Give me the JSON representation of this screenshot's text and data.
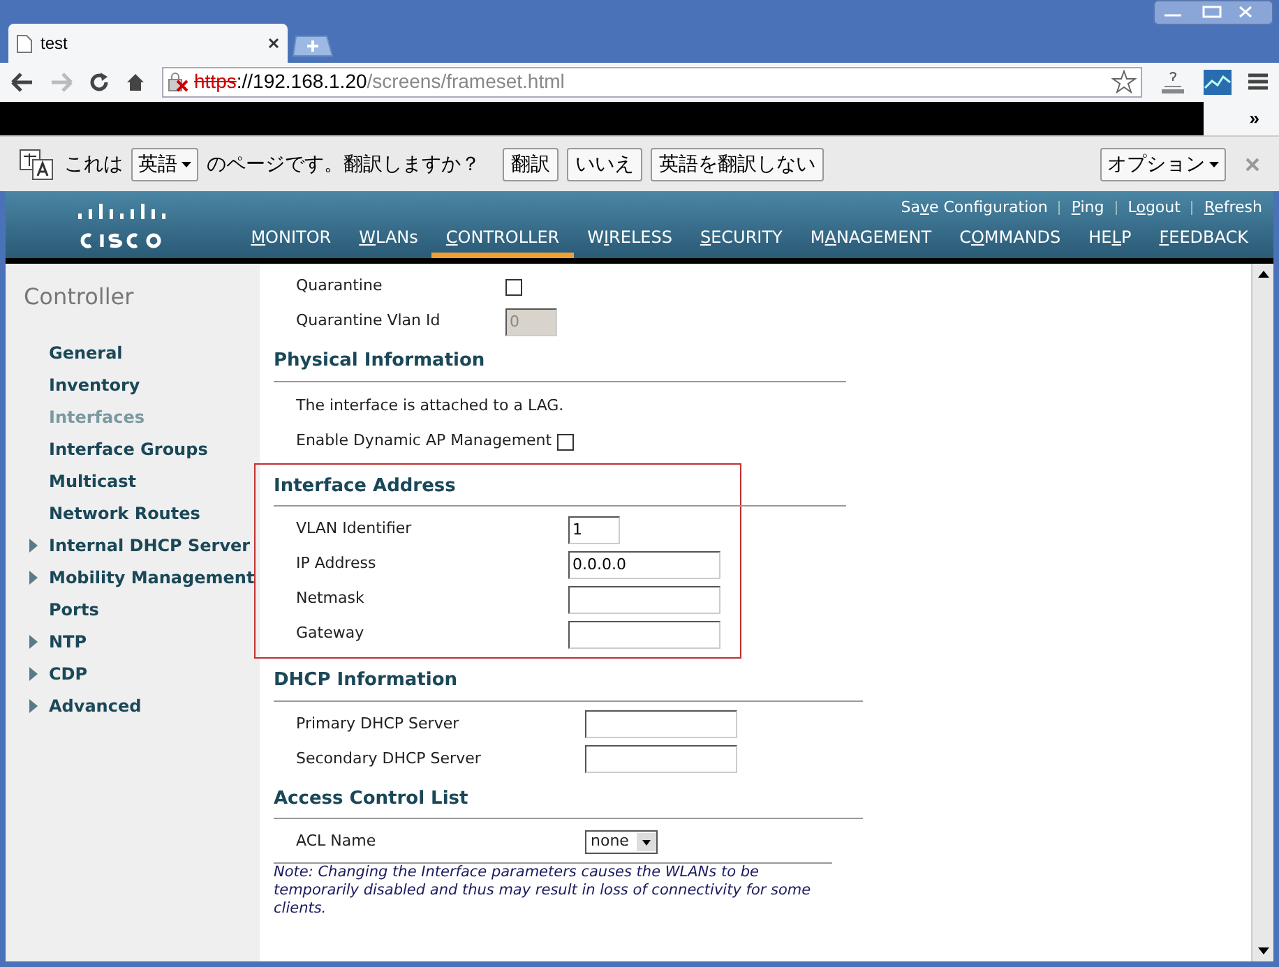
{
  "browser": {
    "tab_title": "test",
    "url_scheme": "https",
    "url_host": "://192.168.1.20",
    "url_path": "/screens/frameset.html",
    "bookmarks_more": "»"
  },
  "translate_bar": {
    "prefix": "これは",
    "language": "英語",
    "suffix": "のページです。翻訳しますか？",
    "buttons": [
      "翻訳",
      "いいえ",
      "英語を翻訳しない"
    ],
    "options": "オプション"
  },
  "header": {
    "links": [
      {
        "pre": "Sa",
        "key": "v",
        "post": "e Configuration"
      },
      {
        "key": "P",
        "post": "ing"
      },
      {
        "pre": "L",
        "key": "o",
        "post": "gout"
      },
      {
        "key": "R",
        "post": "efresh"
      }
    ],
    "nav": [
      {
        "key": "M",
        "post": "ONITOR",
        "selected": false
      },
      {
        "key": "W",
        "post": "LANs",
        "selected": false
      },
      {
        "key": "C",
        "post": "ONTROLLER",
        "selected": true
      },
      {
        "pre": "W",
        "key": "I",
        "post": "RELESS",
        "selected": false
      },
      {
        "key": "S",
        "post": "ECURITY",
        "selected": false
      },
      {
        "pre": "M",
        "key": "A",
        "post": "NAGEMENT",
        "selected": false
      },
      {
        "pre": "C",
        "key": "O",
        "post": "MMANDS",
        "selected": false
      },
      {
        "pre": "HE",
        "key": "L",
        "post": "P",
        "selected": false
      },
      {
        "key": "F",
        "post": "EEDBACK",
        "selected": false
      }
    ]
  },
  "sidebar": {
    "title": "Controller",
    "items": [
      {
        "label": "General",
        "expandable": false,
        "selected": false
      },
      {
        "label": "Inventory",
        "expandable": false,
        "selected": false
      },
      {
        "label": "Interfaces",
        "expandable": false,
        "selected": true
      },
      {
        "label": "Interface Groups",
        "expandable": false,
        "selected": false
      },
      {
        "label": "Multicast",
        "expandable": false,
        "selected": false
      },
      {
        "label": "Network Routes",
        "expandable": false,
        "selected": false
      },
      {
        "label": "Internal DHCP Server",
        "expandable": true,
        "selected": false
      },
      {
        "label": "Mobility Management",
        "expandable": true,
        "selected": false
      },
      {
        "label": "Ports",
        "expandable": false,
        "selected": false
      },
      {
        "label": "NTP",
        "expandable": true,
        "selected": false
      },
      {
        "label": "CDP",
        "expandable": true,
        "selected": false
      },
      {
        "label": "Advanced",
        "expandable": true,
        "selected": false
      }
    ]
  },
  "sections": [
    {
      "highlighted": false,
      "rows": [
        {
          "kind": "checkbox",
          "label": "Quarantine",
          "checked": false
        },
        {
          "kind": "disabled-field",
          "label": "Quarantine Vlan Id",
          "value": "0"
        }
      ]
    },
    {
      "title": "Physical Information",
      "highlighted": false,
      "rows": [
        {
          "kind": "text",
          "label": "The interface is attached to a LAG."
        },
        {
          "kind": "inline-checkbox",
          "label": "Enable Dynamic AP Management",
          "checked": false
        }
      ]
    },
    {
      "title": "Interface Address",
      "highlighted": true,
      "rows": [
        {
          "kind": "short-field",
          "label": "VLAN Identifier",
          "value": "1"
        },
        {
          "kind": "field",
          "label": "IP Address",
          "value": "0.0.0.0"
        },
        {
          "kind": "field",
          "label": "Netmask"
        },
        {
          "kind": "field",
          "label": "Gateway"
        }
      ]
    },
    {
      "title": "DHCP Information",
      "highlighted": false,
      "rows": [
        {
          "kind": "field",
          "label": "Primary DHCP Server"
        },
        {
          "kind": "field",
          "label": "Secondary DHCP Server"
        }
      ]
    },
    {
      "title": "Access Control List",
      "highlighted": false,
      "rows": [
        {
          "kind": "select",
          "label": "ACL Name",
          "value": "none"
        }
      ]
    }
  ],
  "note": "Note: Changing the Interface parameters causes the WLANs to be temporarily disabled and thus may result in loss of connectivity for some clients."
}
